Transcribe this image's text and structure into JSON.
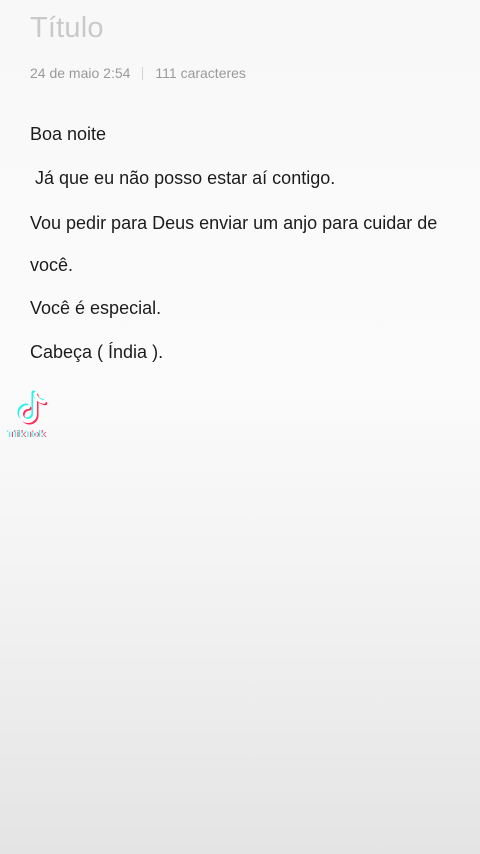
{
  "note": {
    "title_placeholder": "Título",
    "date": "24 de maio  2:54",
    "char_count": "111 caracteres",
    "paragraphs": [
      "Boa noite",
      " Já que eu não posso estar aí contigo.",
      "Vou pedir para Deus enviar um anjo para cuidar de você.",
      "Você é especial.",
      "Cabeça ( Índia )."
    ]
  },
  "watermark": {
    "brand": "TikTok",
    "icon": "tiktok-logo-icon",
    "colors": {
      "cyan": "#25f4ee",
      "red": "#fe2c55"
    }
  },
  "colors": {
    "title_placeholder": "#c9c9c9",
    "meta_text": "#9a9a9a",
    "body_text": "#1c1c1c"
  }
}
